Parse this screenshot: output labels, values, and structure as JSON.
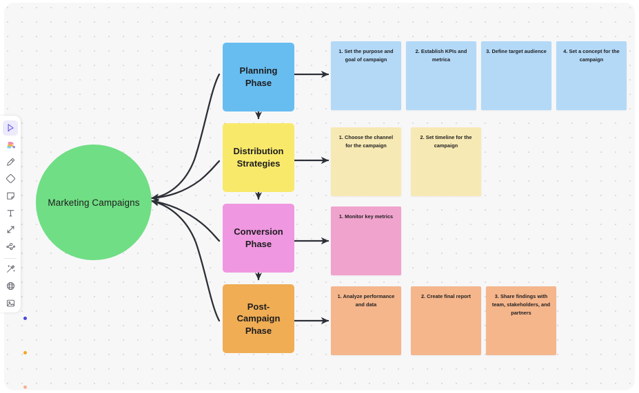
{
  "board": {
    "background_color": "#f7f7f8",
    "dot_color": "#dcdcdf"
  },
  "hub": {
    "label": "Marketing Campaigns",
    "color": "#70de84",
    "shape": "circle"
  },
  "phases": [
    {
      "label": "Planning Phase",
      "color": "#68bdf0",
      "note_color": "#b3d9f7"
    },
    {
      "label": "Distribution\nStrategies",
      "color": "#f9e96b",
      "note_color": "#f7e9b3"
    },
    {
      "label": "Conversion\nPhase",
      "color": "#ef97e0",
      "note_color": "#f0a3cd"
    },
    {
      "label": "Post-Campaign\nPhase",
      "color": "#f0ad54",
      "note_color": "#f5b68c"
    }
  ],
  "phase_labels": {
    "planning": "Planning Phase",
    "distribution_line1": "Distribution",
    "distribution_line2": "Strategies",
    "conversion_line1": "Conversion",
    "conversion_line2": "Phase",
    "post_campaign_line1": "Post-Campaign",
    "post_campaign_line2": "Phase"
  },
  "notes": {
    "planning": [
      "1. Set the purpose and goal of campaign",
      "2.  Establish KPIs and metrica",
      "3. Define target audience",
      "4. Set a concept for the campaign"
    ],
    "distribution": [
      "1. Choose the channel for the campaign",
      "2. Set timeline for the campaign"
    ],
    "conversion": [
      "1. Monitor key metrics"
    ],
    "post_campaign": [
      "1. Analyze performance and data",
      "2. Create final report",
      "3. Share findings with team, stakeholders, and partners"
    ]
  },
  "toolbar": {
    "items": [
      {
        "icon": "cursor-select-icon",
        "selected": true
      },
      {
        "icon": "sticky-notes-icon",
        "selected": false
      },
      {
        "icon": "pen-marker-icon",
        "selected": false
      },
      {
        "icon": "shape-diamond-icon",
        "selected": false
      },
      {
        "icon": "note-card-icon",
        "selected": false
      },
      {
        "icon": "text-icon",
        "selected": false
      },
      {
        "icon": "connector-arrow-icon",
        "selected": false
      },
      {
        "icon": "mindmap-icon",
        "selected": false
      },
      {
        "icon": "magic-wand-icon",
        "selected": false
      },
      {
        "icon": "globe-icon",
        "selected": false
      },
      {
        "icon": "image-icon",
        "selected": false
      }
    ],
    "color_dots": [
      {
        "name": "color-swatch-indigo",
        "color": "#4a46e0"
      },
      {
        "name": "color-swatch-amber",
        "color": "#f5a623"
      },
      {
        "name": "color-swatch-peach",
        "color": "#f3b391"
      }
    ]
  }
}
